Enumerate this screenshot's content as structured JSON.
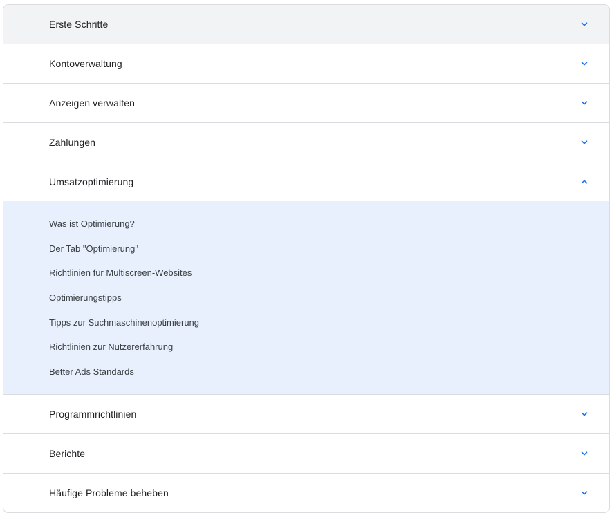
{
  "accordion": {
    "sections": [
      {
        "title": "Erste Schritte",
        "expanded": false
      },
      {
        "title": "Kontoverwaltung",
        "expanded": false
      },
      {
        "title": "Anzeigen verwalten",
        "expanded": false
      },
      {
        "title": "Zahlungen",
        "expanded": false
      },
      {
        "title": "Umsatzoptimierung",
        "expanded": true,
        "items": [
          "Was ist Optimierung?",
          "Der Tab \"Optimierung\"",
          "Richtlinien für Multiscreen-Websites",
          "Optimierungstipps",
          "Tipps zur Suchmaschinenoptimierung",
          "Richtlinien zur Nutzererfahrung",
          "Better Ads Standards"
        ]
      },
      {
        "title": "Programmrichtlinien",
        "expanded": false
      },
      {
        "title": "Berichte",
        "expanded": false
      },
      {
        "title": "Häufige Probleme beheben",
        "expanded": false
      }
    ],
    "icons": {
      "collapsed": "chevron-down-icon",
      "expanded": "chevron-up-icon"
    },
    "colors": {
      "chevron": "#1a73e8",
      "expanded_background": "#e8f0fe",
      "hover_background": "#f1f3f4",
      "divider": "#dadce0"
    }
  }
}
